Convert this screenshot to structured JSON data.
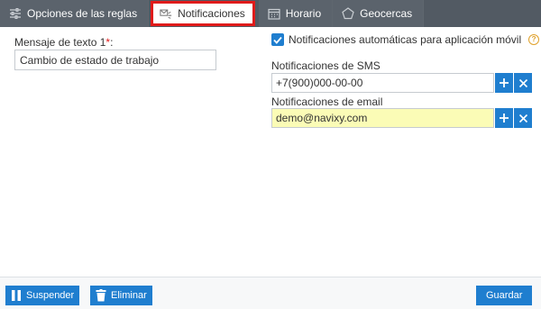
{
  "tabs": [
    {
      "label": "Opciones de las reglas",
      "icon": "sliders-icon",
      "active": false
    },
    {
      "label": "Notificaciones",
      "icon": "notification-icon",
      "active": true
    },
    {
      "label": "Horario",
      "icon": "calendar-icon",
      "active": false
    },
    {
      "label": "Geocercas",
      "icon": "pentagon-icon",
      "active": false
    }
  ],
  "message": {
    "label": "Mensaje de texto 1",
    "required_mark": "*",
    "colon": ":",
    "value": "Cambio de estado de trabajo"
  },
  "auto_notifications": {
    "checked": true,
    "label": "Notificaciones automáticas para aplicación móvil"
  },
  "sms": {
    "label": "Notificaciones de SMS",
    "value": "+7(900)000-00-00"
  },
  "email": {
    "label": "Notificaciones de email",
    "value": "demo@navixy.com"
  },
  "footer": {
    "suspend_label": "Suspender",
    "delete_label": "Eliminar",
    "save_label": "Guardar"
  },
  "colors": {
    "accent": "#1f7ecf",
    "tabbar": "#525a63",
    "active_tab_border": "#e01b1b",
    "email_highlight": "#fbfcb6"
  }
}
